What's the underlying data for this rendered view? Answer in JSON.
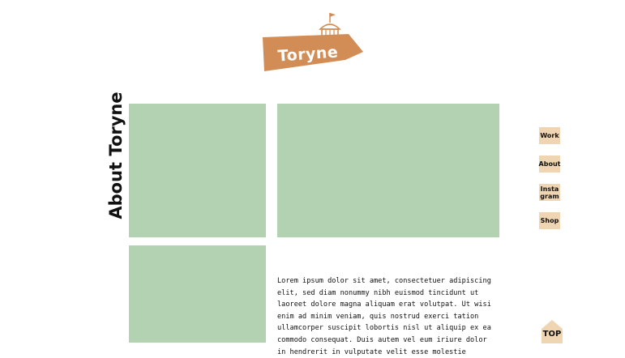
{
  "brand": {
    "logo_text": "Toryne",
    "accent_color": "#d28d56",
    "flag_icon": "circus-tent-icon"
  },
  "page": {
    "side_title": "About Toryne",
    "placeholder_color": "#b3d2b1",
    "body_text": "Lorem ipsum dolor sit amet, consectetuer adipiscing elit, sed diam nonummy nibh euismod tincidunt ut laoreet dolore magna aliquam erat volutpat. Ut wisi enim ad minim veniam, quis nostrud exerci tation ullamcorper suscipit lobortis nisl ut aliquip ex ea commodo consequat. Duis autem vel eum iriure dolor in hendrerit in vulputate velit esse molestie"
  },
  "nav": {
    "bg_color": "#f0d5b2",
    "work": "Work",
    "about": "About",
    "insta_line1": "Insta",
    "insta_line2": "gram",
    "shop": "Shop"
  },
  "top_button": {
    "label": "TOP"
  }
}
